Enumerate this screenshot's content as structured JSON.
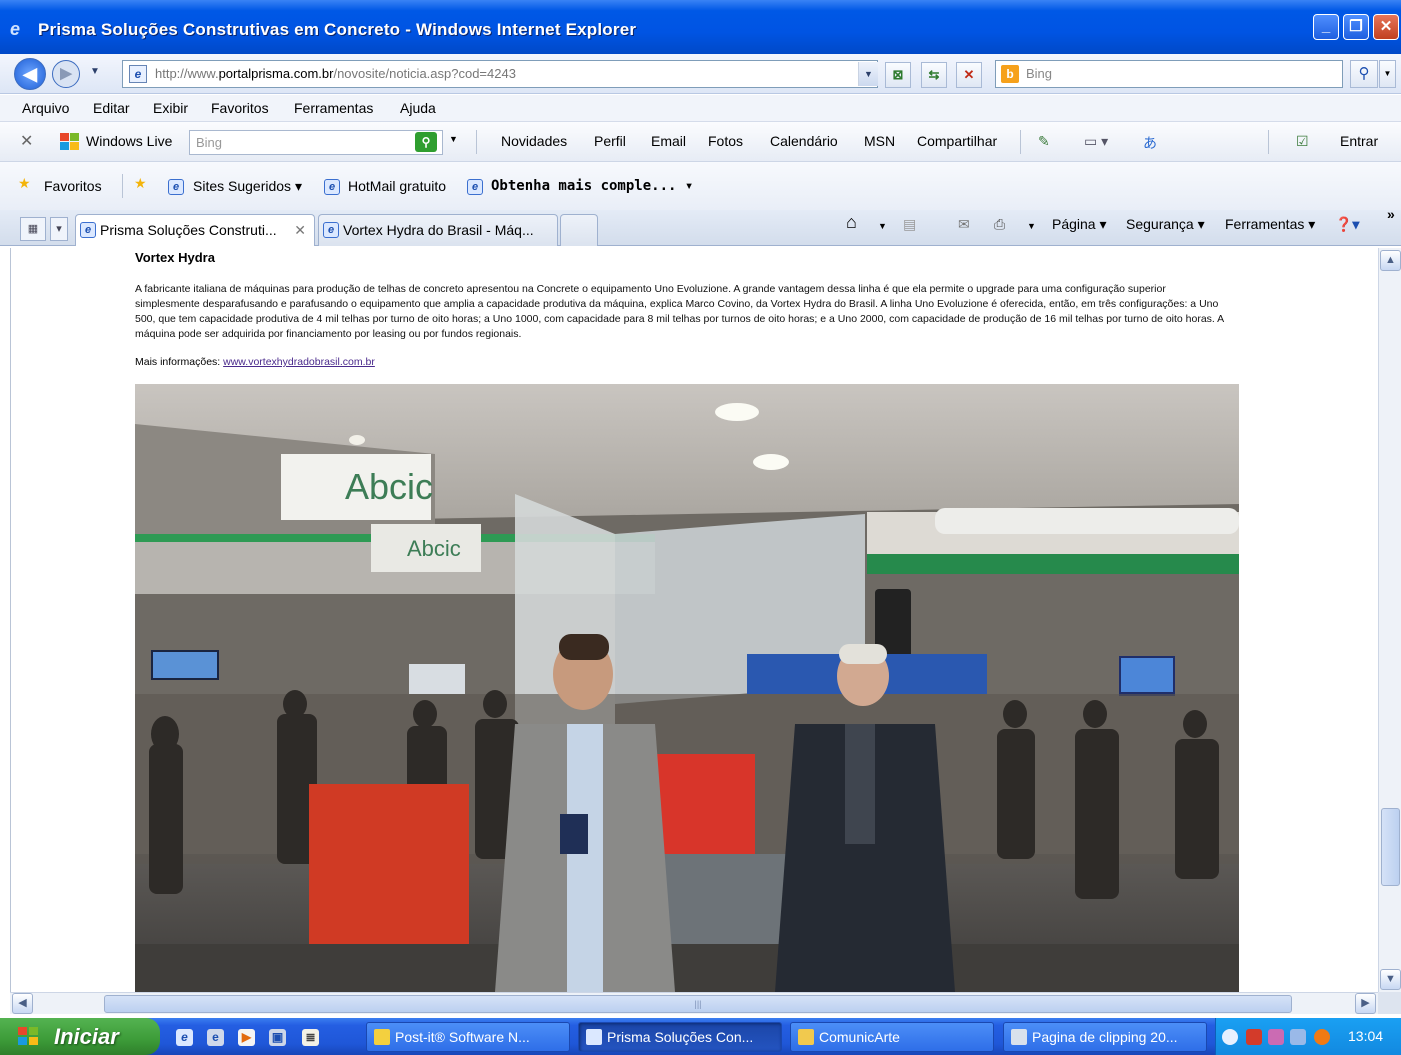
{
  "window": {
    "title": "Prisma Soluções Construtivas em Concreto - Windows Internet Explorer",
    "controls": {
      "minimize": "_",
      "maximize": "❐",
      "close": "✕"
    }
  },
  "address_bar": {
    "url_prefix": "http://www.",
    "url_domain": "portalprisma.com.br",
    "url_path": "/novosite/noticia.asp?cod=4243",
    "search_placeholder": "Bing"
  },
  "menu": [
    "Arquivo",
    "Editar",
    "Exibir",
    "Favoritos",
    "Ferramentas",
    "Ajuda"
  ],
  "live_toolbar": {
    "brand": "Windows Live",
    "search_placeholder": "Bing",
    "links": [
      "Novidades",
      "Perfil",
      "Email",
      "Fotos",
      "Calendário",
      "MSN",
      "Compartilhar"
    ],
    "signin": "Entrar"
  },
  "favorites_bar": {
    "favorites_label": "Favoritos",
    "items": [
      "Sites Sugeridos ▾",
      "HotMail gratuito",
      "Obtenha mais comple... ▾"
    ]
  },
  "tabs": [
    {
      "label": "Prisma Soluções Construti...",
      "active": true
    },
    {
      "label": "Vortex Hydra do Brasil - Máq...",
      "active": false
    }
  ],
  "command_bar": {
    "items": [
      "Página ▾",
      "Segurança ▾",
      "Ferramentas ▾"
    ],
    "chevron": "»"
  },
  "article": {
    "title": "Vortex Hydra",
    "body": "A fabricante italiana de máquinas para produção de telhas de concreto apresentou na Concrete o equipamento Uno Evoluzione. A grande vantagem dessa linha é que ela permite o upgrade para uma configuração superior simplesmente desparafusando e parafusando o equipamento que amplia a capacidade produtiva da máquina, explica Marco Covino, da Vortex Hydra do Brasil. A linha Uno Evoluzione é oferecida, então, em três configurações: a Uno 500, que tem capacidade produtiva de 4 mil telhas por turno de oito horas; a Uno 1000, com capacidade para 8 mil telhas por turnos de oito horas; e a Uno 2000, com capacidade de produção de 16 mil telhas por turno de oito horas. A máquina pode ser adquirida por financiamento por leasing ou por fundos regionais.",
    "more_info_label": "Mais informações: ",
    "more_info_link": "www.vortexhydradobrasil.com.br",
    "photo_signs": [
      "Abcic",
      "Abcic"
    ]
  },
  "taskbar": {
    "start_label": "Iniciar",
    "tasks": [
      {
        "label": "Post-it® Software N...",
        "active": false
      },
      {
        "label": "Prisma Soluções Con...",
        "active": true
      },
      {
        "label": "ComunicArte",
        "active": false
      },
      {
        "label": "Pagina de clipping 20...",
        "active": false
      }
    ],
    "clock": "13:04"
  },
  "colors": {
    "titlebar": "#0054e3",
    "start_button": "#3c9b38",
    "taskbar": "#245ee2",
    "tray": "#1289e0",
    "link": "#4a2a8c"
  }
}
